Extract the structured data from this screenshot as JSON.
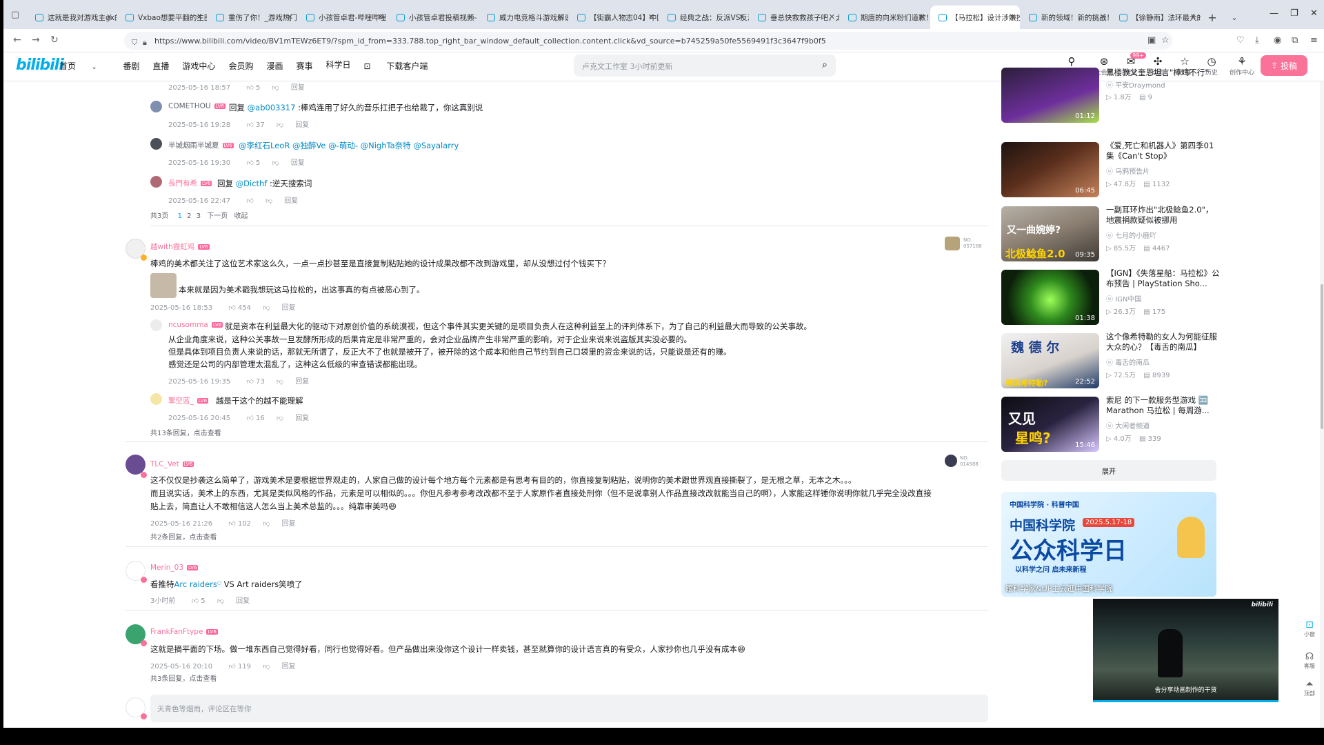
{
  "browser": {
    "tabs": [
      {
        "label": "这就是我对游戏主gx的"
      },
      {
        "label": "Vxbao想要平翻的生图"
      },
      {
        "label": "重伤了你！_游戏热门"
      },
      {
        "label": "小孩管卓君-哔哩哔哩"
      },
      {
        "label": "小孩管卓君投稿视频-"
      },
      {
        "label": "威力电竞格斗游戏解说"
      },
      {
        "label": "【街霸人物志04】中国"
      },
      {
        "label": "经典之战：反派VS反派"
      },
      {
        "label": "垂总快救救孩子吧，太"
      },
      {
        "label": "期唐的向米粉们道歉！"
      },
      {
        "label": "【马拉松】设计涉嫌抄"
      },
      {
        "label": "新的领域！新的挑战！"
      },
      {
        "label": "【徐静雨】法环最大的"
      }
    ],
    "url": "https://www.bilibili.com/video/BV1mTEWz6ET9/?spm_id_from=333.788.top_right_bar_window_default_collection.content.click&vd_source=b745259a50fe5569491f3c3647f9b0f5"
  },
  "header": {
    "logo": "bilibili",
    "nav": [
      "首页",
      "番剧",
      "直播",
      "游戏中心",
      "会员购",
      "漫画",
      "赛事",
      "科学日",
      "下载客户端"
    ],
    "search_placeholder": "卢克文工作室 3小时前更新",
    "icons": [
      {
        "label": "大会员"
      },
      {
        "label": "消息",
        "badge": "99+"
      },
      {
        "label": "动态"
      },
      {
        "label": "收藏"
      },
      {
        "label": "历史"
      },
      {
        "label": "创作中心"
      }
    ],
    "upload": "投稿"
  },
  "comments": {
    "r0": {
      "date": "2025-05-16 18:57",
      "likes": "5",
      "reply": "回复"
    },
    "r1": {
      "user": "COMETHOU",
      "prefix": "回复",
      "at": "@ab003317",
      "text": ":棒鸡连用了好久的音乐扛把子也给裁了，你这真别说",
      "date": "2025-05-16 19:28",
      "likes": "37",
      "reply": "回复"
    },
    "r2": {
      "user": "半城烟雨半城夏",
      "ats": "@李红石LeoR @独醉Ve @-萌动- @NighTa奈特 @Sayalarry",
      "date": "2025-05-16 19:30",
      "likes": "5",
      "reply": "回复"
    },
    "r3": {
      "user": "長門有希",
      "prefix": "回复",
      "at": "@Dicthf",
      "text": ":逆天搜索词",
      "date": "2025-05-16 22:47",
      "reply": "回复"
    },
    "pager": {
      "total": "共3页",
      "p1": "1",
      "p2": "2",
      "p3": "3",
      "next": "下一页",
      "collapse": "收起"
    },
    "c1": {
      "user": "越with霞虹鸡",
      "line1": "棒鸡的美术都关注了这位艺术家这么久，一点一点抄甚至是直接复制粘贴她的设计成果改都不改到游戏里，却从没想过付个钱买下？",
      "line2": "本来就是因为美术戳我想玩这马拉松的，出这事真的有点被恶心到了。",
      "date": "2025-05-16 18:53",
      "likes": "454",
      "reply": "回复",
      "sticker": "NO.\n057188"
    },
    "c1r1": {
      "user": "ncusomma",
      "line1": "就是资本在利益最大化的驱动下对原创价值的系统漠视，但这个事件其实更关键的是项目负责人在这种利益至上的评判体系下，为了自己的利益最大而导致的公关事故。",
      "line2": "从企业角度来说，这种公关事故一旦发酵所形成的后果肯定是非常严重的，会对企业品牌产生非常严重的影响，对于企业来说来说盗版其实没必要的。",
      "line3": "但是具体到项目负责人来说的话，那就无所谓了，反正大不了也就是被开了，被开除的这个成本和他自己节约到自己口袋里的资金来说的话，只能说是还有的赚。",
      "line4": "感觉还是公司的内部管理太混乱了，这种这么低级的审查错误都能出现。",
      "date": "2025-05-16 19:35",
      "likes": "73",
      "reply": "回复"
    },
    "c1r2": {
      "user": "擎空蓝_",
      "text": "越是干这个的越不能理解",
      "date": "2025-05-16 20:45",
      "likes": "16",
      "reply": "回复"
    },
    "c1more": "共13条回复，点击查看",
    "c2": {
      "user": "TLC_Vet",
      "line1": "这不仅仅是抄袭这么简单了，游戏美术是要根据世界观走的，人家自己做的设计每个地方每个元素都是有思考有目的的，你直接复制粘贴，说明你的美术跟世界观直接撕裂了，是无根之草，无本之木。。。",
      "line2": "而且说实话，美术上的东西，尤其是类似风格的作品，元素是可以相似的。。。你但凡参考参考改改都不至于人家原作者直接处刑你（但不是说拿别人作品直接改改就能当自己的啊），人家能这样锤你说明你就几乎完全没改直接",
      "line3": "贴上去，简直让人不敢相信这人怎么当上美术总监的。。。纯靠审美吗",
      "date": "2025-05-16 21:26",
      "likes": "102",
      "reply": "回复",
      "more": "共2条回复，点击查看",
      "sticker": "NO.\n014588"
    },
    "c3": {
      "user": "Merin_03",
      "text_pre": "看推特",
      "link": "Arc raiders",
      "text_post": " VS Art raiders笑喷了",
      "date": "3小时前",
      "likes": "5",
      "reply": "回复"
    },
    "c4": {
      "user": "FrankFanFtype",
      "text": "这就是摘平面的下场。做一堆东西自己觉得好看，同行也觉得好看。但产品做出来没你这个设计一样卖钱，甚至就算你的设计语言真的有受众，人家抄你也几乎没有成本",
      "date": "2025-05-16 20:10",
      "likes": "119",
      "reply": "回复",
      "more": "共3条回复，点击查看"
    },
    "input_placeholder": "天青色等烟雨，评论区在等你"
  },
  "sidebar": {
    "videos": [
      {
        "title": "黑楼教父奎恩坦言\"棒鸡不行\"",
        "up": "平安Draymond",
        "views": "1.8万",
        "danmaku": "9",
        "duration": "01:12"
      },
      {
        "title": "《爱,死亡和机器人》第四季01集《Can't Stop》",
        "up": "乌鸦预告片",
        "views": "47.8万",
        "danmaku": "1132",
        "duration": "06:45"
      },
      {
        "title": "一副耳环炸出\"北极鲶鱼2.0\"，地震捐款疑似被挪用",
        "up": "七月的小鹿吖",
        "views": "85.5万",
        "danmaku": "4467",
        "duration": "09:35",
        "thumb_top": "又一曲婉婷?",
        "thumb_bottom": "北极鲶鱼2.0"
      },
      {
        "title": "【IGN】《失落星船：马拉松》公布预告 | PlayStation Sho...",
        "up": "IGN中国",
        "views": "26.3万",
        "danmaku": "175",
        "duration": "01:38"
      },
      {
        "title": "这个像希特勒的女人为何能征服大众的心？【毒舌的南瓜】",
        "up": "毒舌的南瓜",
        "views": "72.5万",
        "danmaku": "8939",
        "duration": "22:52",
        "thumb_top": "魏 德 尔",
        "thumb_bottom": "德国希特勒?"
      },
      {
        "title": "索尼 的下一款服务型游戏 🈁 Marathon 马拉松 | 每周游...",
        "up": "大闲者频道",
        "views": "4.0万",
        "danmaku": "339",
        "duration": "15:46",
        "thumb_top": "又见",
        "thumb_bottom": "星鸣?"
      }
    ],
    "expand": "展开",
    "ad": {
      "org": "中国科学院",
      "org2": "科普中国",
      "date": "2025.5.17-18",
      "title": "公众科学日",
      "slogan": "以科学之问  启未来新程",
      "caption": "跟科学家&UP主云逛中国科学院"
    },
    "mini_caption": "舍分享动画制作的干货",
    "mini_logo": "bilibili"
  },
  "tools": [
    {
      "label": "小窗"
    },
    {
      "label": "客服"
    },
    {
      "label": "顶部"
    }
  ]
}
